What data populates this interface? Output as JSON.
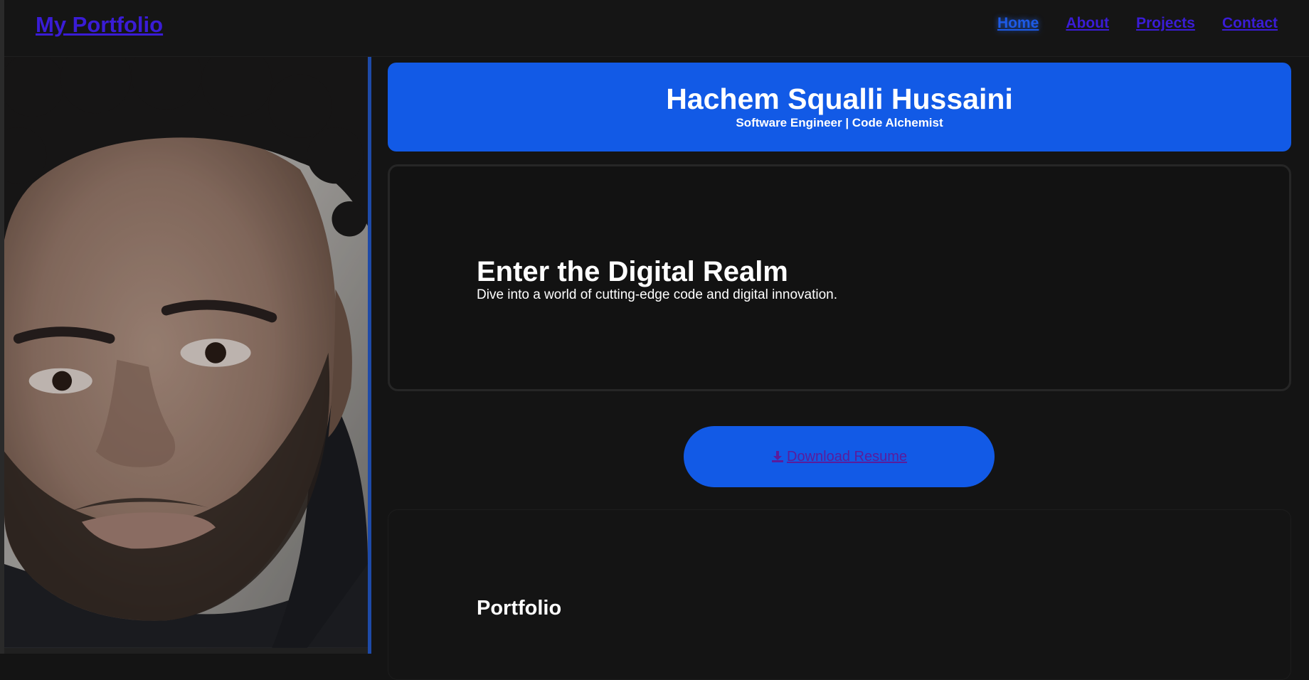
{
  "nav": {
    "brand": "My Portfolio",
    "links": [
      {
        "label": "Home",
        "active": true
      },
      {
        "label": "About",
        "active": false
      },
      {
        "label": "Projects",
        "active": false
      },
      {
        "label": "Contact",
        "active": false
      }
    ]
  },
  "photo": {
    "icon": "profile-photo"
  },
  "header": {
    "name": "Hachem Squalli Hussaini",
    "subtitle": "Software Engineer | Code Alchemist"
  },
  "hero": {
    "title": "Enter the Digital Realm",
    "text": "Dive into a world of cutting-edge code and digital innovation."
  },
  "resume": {
    "label": "Download Resume",
    "icon": "download-icon"
  },
  "portfolio": {
    "title": "Portfolio"
  },
  "colors": {
    "accent": "#125ae6",
    "link": "#3a1cd6",
    "background": "#141414"
  }
}
